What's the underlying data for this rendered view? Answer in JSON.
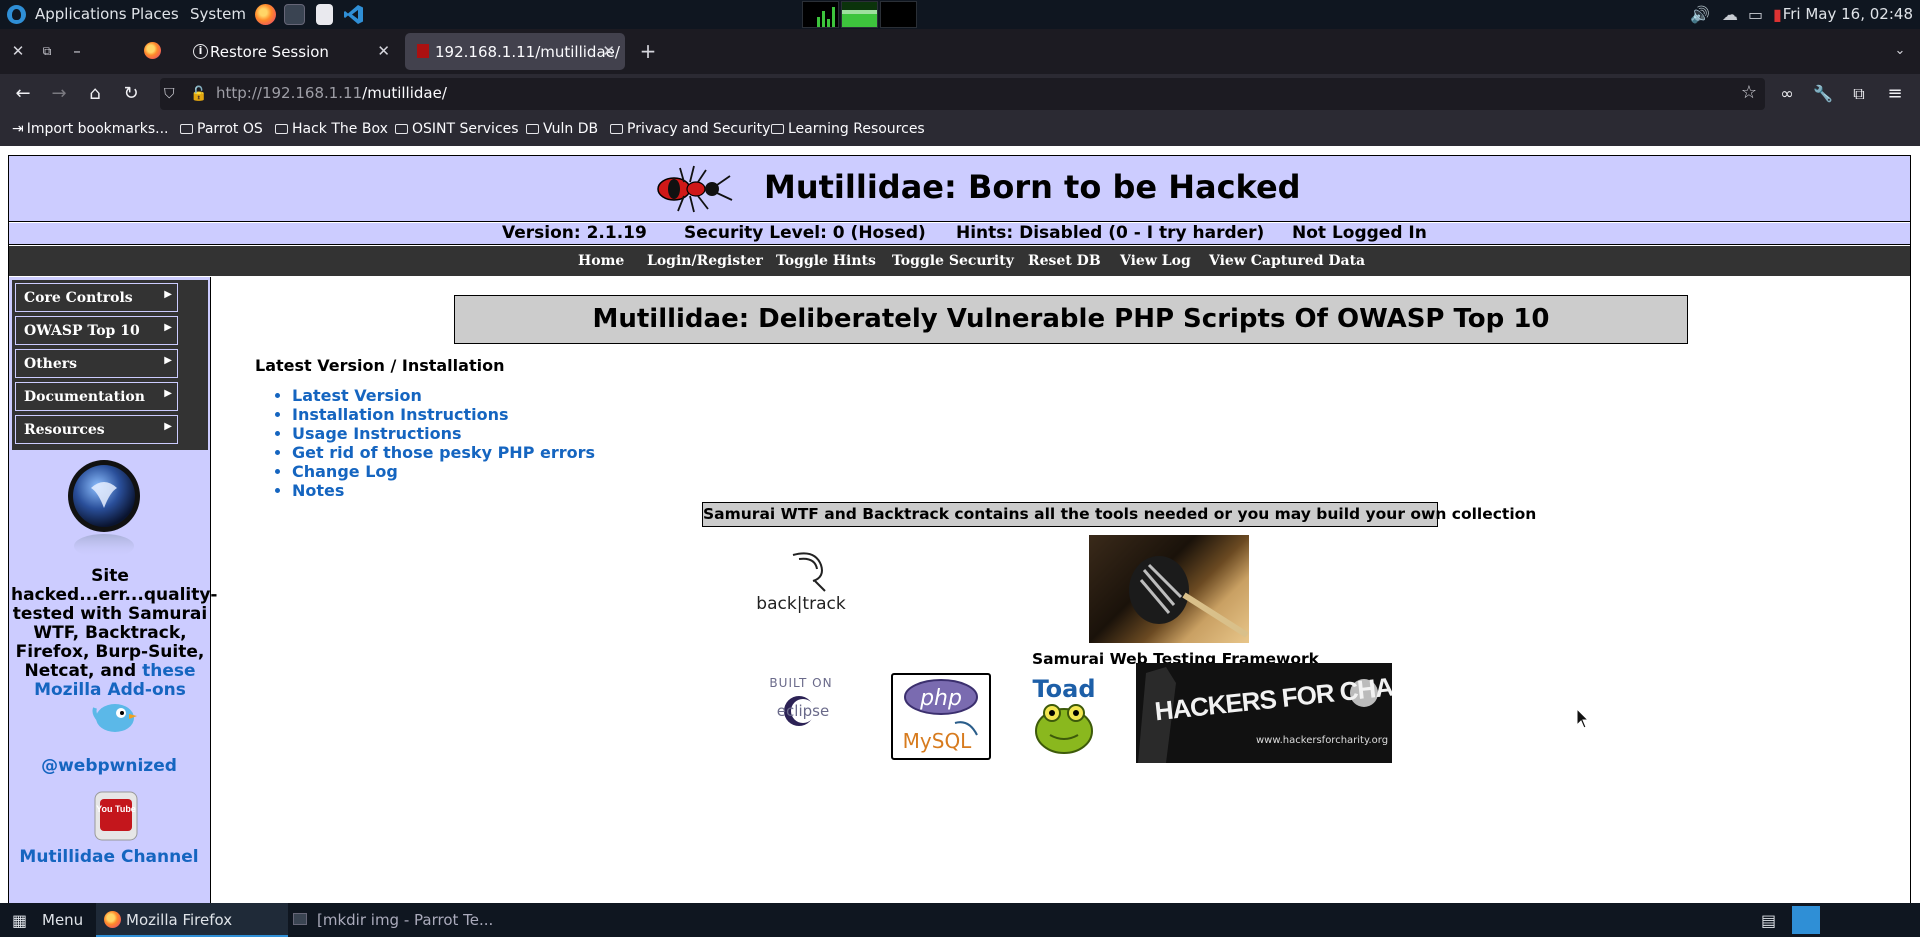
{
  "os_panel": {
    "menus": [
      "Applications",
      "Places",
      "System"
    ],
    "clock": "Fri May 16, 02:48"
  },
  "browser": {
    "tabs": [
      {
        "label": "Restore Session",
        "active": false
      },
      {
        "label": "192.168.1.11/mutillidae/",
        "active": true
      }
    ],
    "new_tab": "+",
    "url_host": "http://192.168.1.11",
    "url_path": "/mutillidae/",
    "bookmarks": [
      {
        "label": "Import bookmarks...",
        "icon": "import-icon"
      },
      {
        "label": "Parrot OS",
        "icon": "folder-icon"
      },
      {
        "label": "Hack The Box",
        "icon": "folder-icon"
      },
      {
        "label": "OSINT Services",
        "icon": "folder-icon"
      },
      {
        "label": "Vuln DB",
        "icon": "folder-icon"
      },
      {
        "label": "Privacy and Security",
        "icon": "folder-icon"
      },
      {
        "label": "Learning Resources",
        "icon": "folder-icon"
      }
    ]
  },
  "site": {
    "title": "Mutillidae: Born to be Hacked",
    "version": "Version: 2.1.19",
    "security": "Security Level: 0 (Hosed)",
    "hints": "Hints: Disabled (0 - I try harder)",
    "login_status": "Not Logged In",
    "top_menu": [
      "Home",
      "Login/Register",
      "Toggle Hints",
      "Toggle Security",
      "Reset DB",
      "View Log",
      "View Captured Data"
    ],
    "side_menu": [
      "Core Controls",
      "OWASP Top 10",
      "Others",
      "Documentation",
      "Resources"
    ],
    "side_text": "Site hacked...err...quality-tested with Samurai WTF, Backtrack, Firefox, Burp-Suite, Netcat, and",
    "side_link": "these Mozilla Add-ons",
    "twitter": "@webpwnized",
    "youtube": "Mutillidae Channel",
    "main_heading": "Mutillidae: Deliberately Vulnerable PHP Scripts Of OWASP Top 10",
    "install_heading": "Latest Version / Installation",
    "install_links": [
      "Latest Version",
      "Installation Instructions",
      "Usage Instructions",
      "Get rid of those pesky PHP errors",
      "Change Log",
      "Notes"
    ],
    "tools_box": "Samurai WTF and Backtrack contains all the tools needed or you may build your own collection",
    "backtrack_label": "back|track",
    "samurai_caption": "Samurai Web Testing Framework",
    "eclipse_label_top": "BUILT ON",
    "eclipse_label": "eclipse",
    "php_label": "php",
    "mysql_label": "MySQL",
    "toad_label": "Toad",
    "hfc_label": "HACKERS FOR CHARITY",
    "hfc_url": "www.hackersforcharity.org",
    "youtube_badge": "You Tube"
  },
  "taskbar": {
    "menu": "Menu",
    "tasks": [
      {
        "label": "Mozilla Firefox",
        "active": true
      },
      {
        "label": "[mkdir img - Parrot Te...",
        "active": false
      }
    ]
  },
  "colors": {
    "site_header_bg": "#ccccff",
    "menu_bg": "#333333",
    "link": "#1565c0",
    "panel_bg": "#0f1620"
  }
}
